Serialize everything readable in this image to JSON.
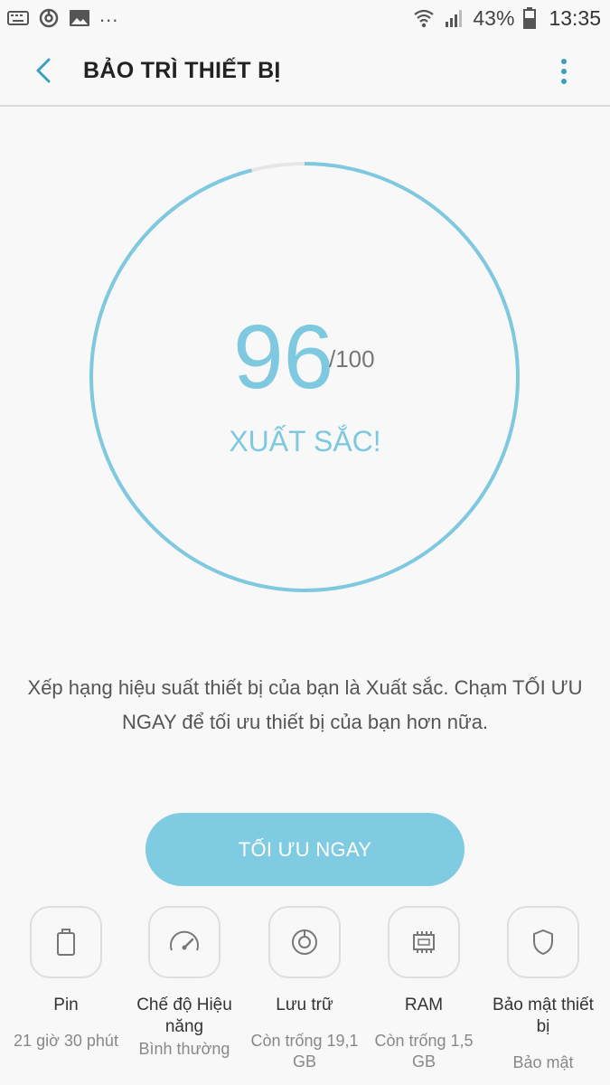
{
  "status_bar": {
    "battery_percent": "43%",
    "time": "13:35",
    "more_indicator": "...",
    "icons": [
      "keyboard-icon",
      "sync-icon",
      "image-icon",
      "wifi-icon",
      "signal-icon",
      "battery-icon"
    ]
  },
  "app_bar": {
    "title": "BẢO TRÌ THIẾT BỊ",
    "back_icon": "chevron-left-icon",
    "menu_icon": "more-vertical-icon"
  },
  "score": {
    "value": "96",
    "max": "/100",
    "rating": "XUẤT SẮC!",
    "fraction": 0.96
  },
  "description": "Xếp hạng hiệu suất thiết bị của bạn là Xuất sắc. Chạm TỐI ƯU NGAY để tối ưu thiết bị của bạn hơn nữa.",
  "optimize_button": "TỐI ƯU NGAY",
  "items": [
    {
      "title": "Pin",
      "subtitle": "21 giờ 30 phút",
      "icon": "battery-icon"
    },
    {
      "title": "Chế độ Hiệu năng",
      "subtitle": "Bình thường",
      "icon": "speedometer-icon"
    },
    {
      "title": "Lưu trữ",
      "subtitle": "Còn trống 19,1 GB",
      "icon": "storage-icon"
    },
    {
      "title": "RAM",
      "subtitle": "Còn trống 1,5 GB",
      "icon": "memory-chip-icon"
    },
    {
      "title": "Bảo mật thiết bị",
      "subtitle": "Bảo mật",
      "icon": "shield-icon"
    }
  ],
  "colors": {
    "accent": "#7ec9df",
    "button": "#7ecbe2",
    "ring_track": "#e6e6e6",
    "background": "#f8f8f8"
  }
}
